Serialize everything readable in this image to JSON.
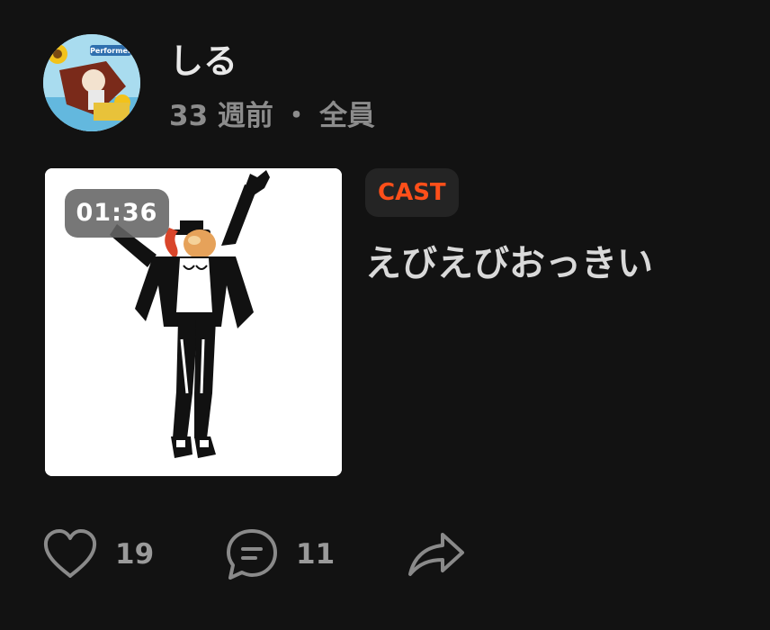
{
  "post": {
    "author": {
      "name": "しる",
      "avatar_text": "Performer"
    },
    "meta": {
      "age": "33 週前",
      "separator": "・",
      "audience": "全員"
    },
    "media": {
      "duration": "01:36"
    },
    "tag": "CAST",
    "title": "えびえびおっきい",
    "actions": {
      "likes": "19",
      "comments": "11"
    }
  },
  "colors": {
    "background": "#121212",
    "tag_text": "#ff4f1a",
    "tag_bg": "#242424",
    "text_primary": "#e8e8e8",
    "text_secondary": "#8c8c8c"
  },
  "icons": {
    "like": "heart-outline-icon",
    "comment": "chat-bubble-icon",
    "share": "share-arrow-icon"
  }
}
